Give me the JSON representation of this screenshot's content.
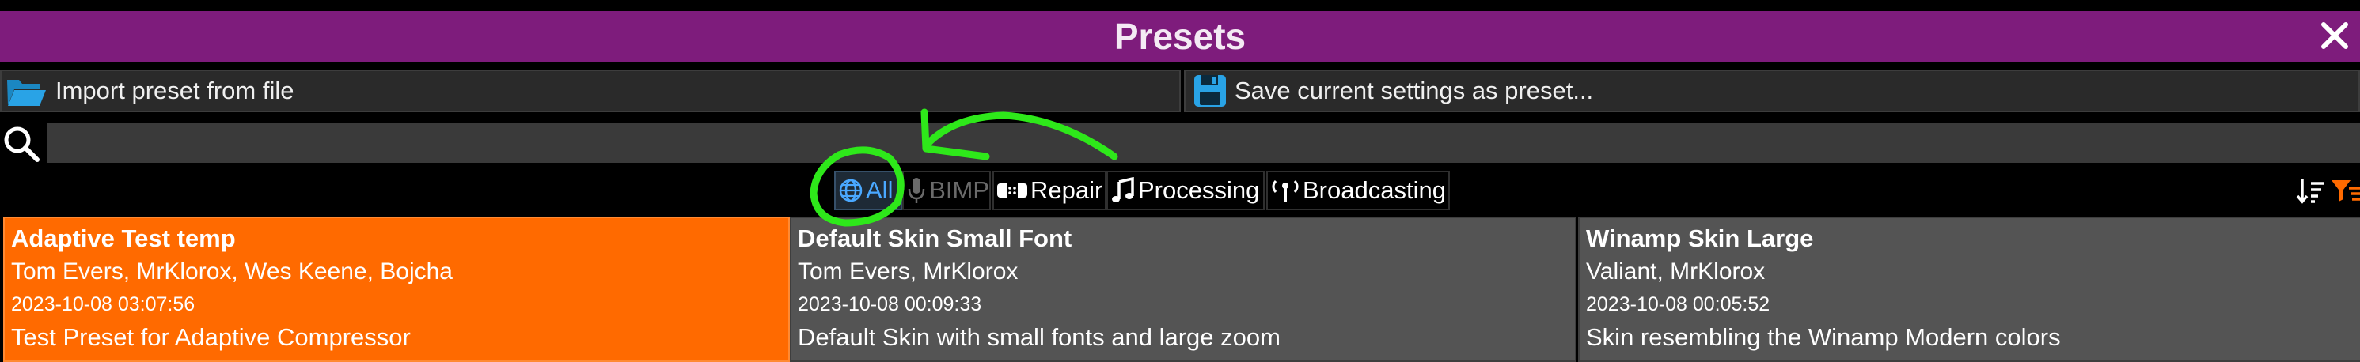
{
  "window": {
    "title": "Presets"
  },
  "toolbar": {
    "import_label": "Import preset from file",
    "save_label": "Save current settings as preset..."
  },
  "search": {
    "value": "",
    "placeholder": ""
  },
  "filters": [
    {
      "label": "All",
      "icon": "globe-icon",
      "state": "active"
    },
    {
      "label": "BIMP",
      "icon": "microphone-icon",
      "state": "disabled"
    },
    {
      "label": "Repair",
      "icon": "bandage-icon",
      "state": "normal"
    },
    {
      "label": "Processing",
      "icon": "music-note-icon",
      "state": "normal"
    },
    {
      "label": "Broadcasting",
      "icon": "antenna-icon",
      "state": "normal"
    }
  ],
  "presets": [
    {
      "name": "Adaptive Test temp",
      "authors": "Tom Evers, MrKlorox, Wes Keene, Bojcha",
      "date": "2023-10-08 03:07:56",
      "description": "Test Preset for Adaptive Compressor",
      "selected": true
    },
    {
      "name": "Default Skin Small Font",
      "authors": "Tom Evers, MrKlorox",
      "date": "2023-10-08 00:09:33",
      "description": "Default Skin with small fonts and large zoom",
      "selected": false
    },
    {
      "name": "Winamp Skin Large",
      "authors": "Valiant, MrKlorox",
      "date": "2023-10-08 00:05:52",
      "description": "Skin resembling the Winamp Modern colors",
      "selected": false
    }
  ],
  "colors": {
    "title_bar": "#7e1c7c",
    "selected_card": "#ff6a00",
    "card": "#545454",
    "active_filter": "#4aa8ff",
    "annotation": "#2ee81a",
    "folder_icon": "#29a3e6",
    "save_icon": "#29a3e6",
    "sort_filter_icon": "#ff6a00"
  }
}
